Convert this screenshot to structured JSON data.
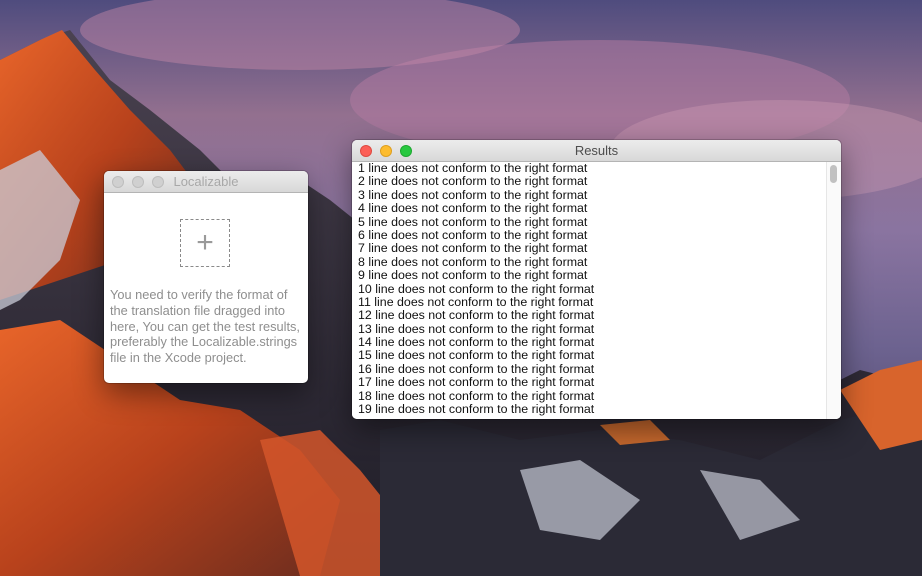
{
  "localizable_window": {
    "title": "Localizable",
    "drop_zone_icon": "plus-icon",
    "instructions": "You need to verify the format of the translation file dragged into here, You can get the test results, preferably the Localizable.strings file in the Xcode project."
  },
  "results_window": {
    "title": "Results",
    "rows": [
      "1 line does not conform to the right format",
      "2 line does not conform to the right format",
      "3 line does not conform to the right format",
      "4 line does not conform to the right format",
      "5 line does not conform to the right format",
      "6 line does not conform to the right format",
      "7 line does not conform to the right format",
      "8 line does not conform to the right format",
      "9 line does not conform to the right format",
      "10 line does not conform to the right format",
      "11 line does not conform to the right format",
      "12 line does not conform to the right format",
      "13 line does not conform to the right format",
      "14 line does not conform to the right format",
      "15 line does not conform to the right format",
      "16 line does not conform to the right format",
      "17 line does not conform to the right format",
      "18 line does not conform to the right format",
      "19 line does not conform to the right format"
    ]
  },
  "colors": {
    "close": "#fc5f57",
    "minimize": "#fdbc2e",
    "zoom": "#28c840"
  }
}
